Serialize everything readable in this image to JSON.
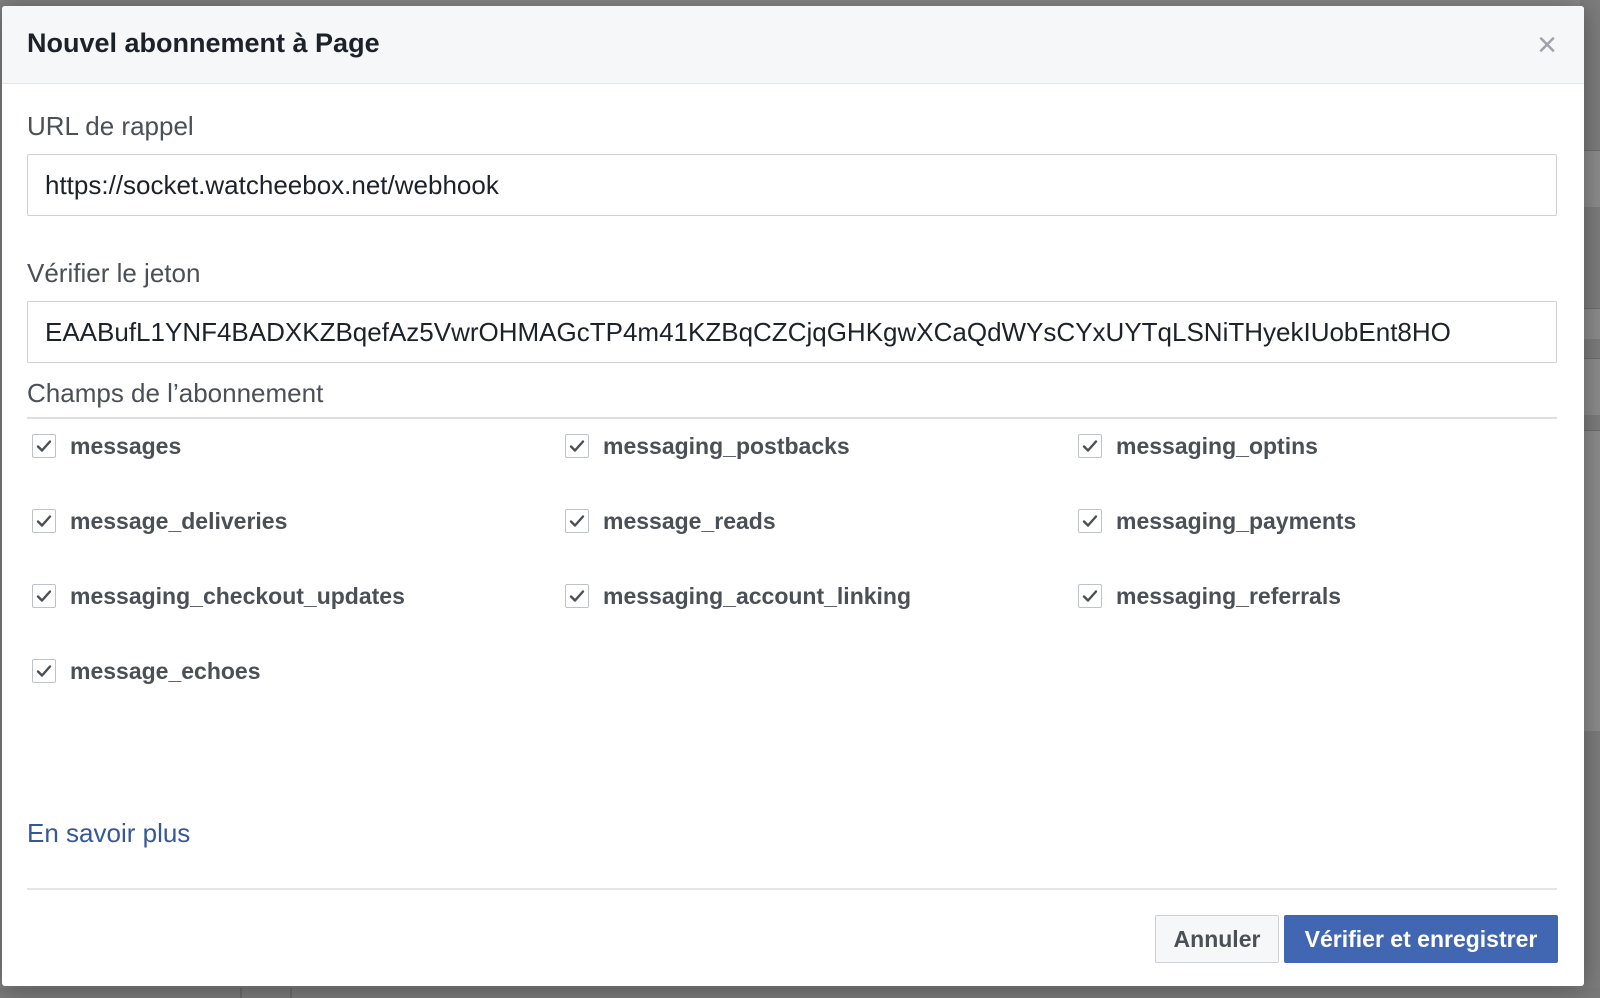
{
  "modal": {
    "title": "Nouvel abonnement à Page",
    "close_glyph": "×"
  },
  "callback_url": {
    "label": "URL de rappel",
    "value": "https://socket.watcheebox.net/webhook"
  },
  "verify_token": {
    "label": "Vérifier le jeton",
    "value": "EAABufL1YNF4BADXKZBqefAz5VwrOHMAGcTP4m41KZBqCZCjqGHKgwXCaQdWYsCYxUYTqLSNiTHyekIUobEnt8HO"
  },
  "subscription_fields": {
    "label": "Champs de l’abonnement",
    "items": [
      {
        "label": "messages",
        "checked": true
      },
      {
        "label": "messaging_postbacks",
        "checked": true
      },
      {
        "label": "messaging_optins",
        "checked": true
      },
      {
        "label": "message_deliveries",
        "checked": true
      },
      {
        "label": "message_reads",
        "checked": true
      },
      {
        "label": "messaging_payments",
        "checked": true
      },
      {
        "label": "messaging_checkout_updates",
        "checked": true
      },
      {
        "label": "messaging_account_linking",
        "checked": true
      },
      {
        "label": "messaging_referrals",
        "checked": true
      },
      {
        "label": "message_echoes",
        "checked": true
      }
    ]
  },
  "footer": {
    "learn_more": "En savoir plus",
    "cancel_label": "Annuler",
    "submit_label": "Vérifier et enregistrer"
  },
  "icons": {
    "close": "close-icon",
    "checkbox": "checkmark-icon"
  },
  "colors": {
    "primary": "#4267b2",
    "link": "#365899",
    "text": "#1d2129",
    "muted": "#4b4f56",
    "checkmark": "#4b4f56"
  }
}
